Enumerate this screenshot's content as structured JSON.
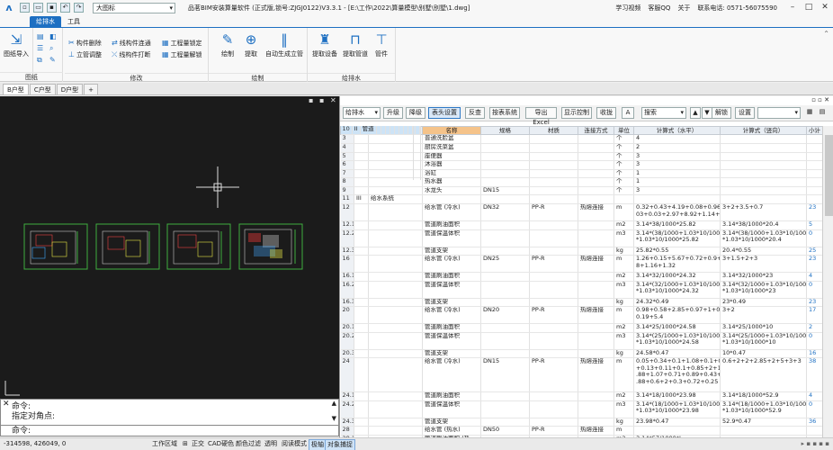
{
  "title_bar": {
    "app_title": "品茗BIM安装算量软件 (正式版,锁号:ZJGJ0122)V3.3.1 - [E:\\工作\\2022\\算量模型\\别墅\\别墅\\1.dwg]",
    "style_select": "大图标",
    "right_links": [
      "学习视频",
      "客服QQ",
      "关于",
      "联系电话: 0571-56075590"
    ]
  },
  "ribbon_tabs": [
    "给排水",
    "工具"
  ],
  "ribbon": {
    "groups": [
      {
        "label": "图纸",
        "buttons": [
          "图纸导入"
        ]
      },
      {
        "label": "修改",
        "buttons": [
          "构件删除",
          "线构件连通",
          "工程量锁定",
          "立管调整",
          "线构件打断",
          "工程量解锁"
        ]
      },
      {
        "label": "绘制",
        "buttons": [
          "绘制",
          "提取",
          "自动生成立管"
        ]
      },
      {
        "label": "给排水",
        "buttons": [
          "提取设备",
          "提取管道",
          "管件"
        ]
      }
    ]
  },
  "doc_tabs": [
    "B户型",
    "C户型",
    "D户型",
    "+"
  ],
  "command": {
    "line1": "命令:",
    "line2": "指定对角点:",
    "prompt": "命令:"
  },
  "status": {
    "coords": "-314598, 426049, 0",
    "items": [
      "工作区域",
      "正交",
      "CAD硬色",
      "颜色过滤",
      "透明",
      "阅读模式",
      "极轴",
      "对象捕捉"
    ]
  },
  "toolbar": {
    "system_select": "给排水",
    "buttons": [
      "升级",
      "降级",
      "表头设置",
      "反查",
      "按表系统",
      "导出Excel",
      "显示控制",
      "收拢",
      "A"
    ],
    "search_placeholder": "搜索",
    "buttons2": [
      "解锁",
      "设置"
    ]
  },
  "table": {
    "headers": [
      "",
      "图标",
      "计算部位",
      "名称",
      "规格",
      "材质",
      "连接方式",
      "单位",
      "计算式（水平）",
      "计算式（竖向）",
      "小计"
    ],
    "rows": [
      {
        "n": "1",
        "icon": "I",
        "part": "水系统",
        "name": "",
        "spec": "",
        "mat": "",
        "conn": "",
        "unit": "",
        "h": "",
        "v": "",
        "sub": "",
        "group": true,
        "sel": true
      },
      {
        "n": "2",
        "icon": "II",
        "part": "卫生器具",
        "name": "",
        "spec": "",
        "mat": "",
        "conn": "",
        "unit": "",
        "h": "",
        "v": "",
        "sub": "",
        "group": true
      },
      {
        "n": "3",
        "icon": "",
        "part": "",
        "name": "普通洗脸盆",
        "spec": "",
        "mat": "",
        "conn": "",
        "unit": "个",
        "h": "4",
        "v": "",
        "sub": ""
      },
      {
        "n": "4",
        "icon": "",
        "part": "",
        "name": "厨房洗菜盆",
        "spec": "",
        "mat": "",
        "conn": "",
        "unit": "个",
        "h": "2",
        "v": "",
        "sub": ""
      },
      {
        "n": "5",
        "icon": "",
        "part": "",
        "name": "座便器",
        "spec": "",
        "mat": "",
        "conn": "",
        "unit": "个",
        "h": "3",
        "v": "",
        "sub": ""
      },
      {
        "n": "6",
        "icon": "",
        "part": "",
        "name": "沐浴器",
        "spec": "",
        "mat": "",
        "conn": "",
        "unit": "个",
        "h": "3",
        "v": "",
        "sub": ""
      },
      {
        "n": "7",
        "icon": "",
        "part": "",
        "name": "浴缸",
        "spec": "",
        "mat": "",
        "conn": "",
        "unit": "个",
        "h": "1",
        "v": "",
        "sub": ""
      },
      {
        "n": "8",
        "icon": "",
        "part": "",
        "name": "热水器",
        "spec": "",
        "mat": "",
        "conn": "",
        "unit": "个",
        "h": "1",
        "v": "",
        "sub": ""
      },
      {
        "n": "9",
        "icon": "",
        "part": "",
        "name": "水龙头",
        "spec": "DN15",
        "mat": "",
        "conn": "",
        "unit": "个",
        "h": "3",
        "v": "",
        "sub": ""
      },
      {
        "n": "10",
        "icon": "II",
        "part": "管道",
        "name": "",
        "spec": "",
        "mat": "",
        "conn": "",
        "unit": "",
        "h": "",
        "v": "",
        "sub": "",
        "group": true
      },
      {
        "n": "11",
        "icon": "III",
        "part": "给水系统",
        "name": "",
        "spec": "",
        "mat": "",
        "conn": "",
        "unit": "",
        "h": "",
        "v": "",
        "sub": ""
      },
      {
        "n": "12",
        "icon": "",
        "part": "",
        "name": "给水管 (冷水)",
        "spec": "DN32",
        "mat": "PP-R",
        "conn": "热熔连接",
        "unit": "m",
        "h": "0.32+0.43+4.19+0.08+0.96+1.",
        "h2": "03+0.03+2.97+8.92+1.14+0.34",
        "v": "3+2+3.5+0.7",
        "sub": "23"
      },
      {
        "n": "12.1",
        "icon": "",
        "part": "",
        "name": "管道刷油面积",
        "spec": "",
        "mat": "",
        "conn": "",
        "unit": "m2",
        "h": "3.14*38/1000*25.82",
        "v": "3.14*38/1000*20.4",
        "sub": "5"
      },
      {
        "n": "12.2",
        "icon": "",
        "part": "",
        "name": "管道保温体积",
        "spec": "",
        "mat": "",
        "conn": "",
        "unit": "m3",
        "h": "3.14*(38/1000+1.03*10/1000)",
        "h2": "*1.03*10/1000*25.82",
        "v": "3.14*(38/1000+1.03*10/1000)",
        "v2": "*1.03*10/1000*20.4",
        "sub": "0"
      },
      {
        "n": "12.3",
        "icon": "",
        "part": "",
        "name": "管道支架",
        "spec": "",
        "mat": "",
        "conn": "",
        "unit": "kg",
        "h": "25.82*0.55",
        "v": "20.4*0.55",
        "sub": "25"
      },
      {
        "n": "16",
        "icon": "",
        "part": "",
        "name": "给水管 (冷水)",
        "spec": "DN25",
        "mat": "PP-R",
        "conn": "热熔连接",
        "unit": "m",
        "h": "1.26+0.15+5.67+0.72+0.9+6.9",
        "h2": "8+1.16+1.32",
        "v": "3+1.5+2+3",
        "sub": "23"
      },
      {
        "n": "16.1",
        "icon": "",
        "part": "",
        "name": "管道刷油面积",
        "spec": "",
        "mat": "",
        "conn": "",
        "unit": "m2",
        "h": "3.14*32/1000*24.32",
        "v": "3.14*32/1000*23",
        "sub": "4"
      },
      {
        "n": "16.2",
        "icon": "",
        "part": "",
        "name": "管道保温体积",
        "spec": "",
        "mat": "",
        "conn": "",
        "unit": "m3",
        "h": "3.14*(32/1000+1.03*10/1000)",
        "h2": "*1.03*10/1000*24.32",
        "v": "3.14*(32/1000+1.03*10/1000)",
        "v2": "*1.03*10/1000*23",
        "sub": "0"
      },
      {
        "n": "16.3",
        "icon": "",
        "part": "",
        "name": "管道支架",
        "spec": "",
        "mat": "",
        "conn": "",
        "unit": "kg",
        "h": "24.32*0.49",
        "v": "23*0.49",
        "sub": "23"
      },
      {
        "n": "20",
        "icon": "",
        "part": "",
        "name": "给水管 (冷水)",
        "spec": "DN20",
        "mat": "PP-R",
        "conn": "热熔连接",
        "unit": "m",
        "h": "0.98+0.58+2.85+0.97+1+0.32+",
        "h2": "0.19+5.4",
        "v": "3+2",
        "sub": "17"
      },
      {
        "n": "20.1",
        "icon": "",
        "part": "",
        "name": "管道刷油面积",
        "spec": "",
        "mat": "",
        "conn": "",
        "unit": "m2",
        "h": "3.14*25/1000*24.58",
        "v": "3.14*25/1000*10",
        "sub": "2"
      },
      {
        "n": "20.2",
        "icon": "",
        "part": "",
        "name": "管道保温体积",
        "spec": "",
        "mat": "",
        "conn": "",
        "unit": "m3",
        "h": "3.14*(25/1000+1.03*10/1000)",
        "h2": "*1.03*10/1000*24.58",
        "v": "3.14*(25/1000+1.03*10/1000)",
        "v2": "*1.03*10/1000*10",
        "sub": "0"
      },
      {
        "n": "20.3",
        "icon": "",
        "part": "",
        "name": "管道支架",
        "spec": "",
        "mat": "",
        "conn": "",
        "unit": "kg",
        "h": "24.58*0.47",
        "v": "10*0.47",
        "sub": "16"
      },
      {
        "n": "24",
        "icon": "",
        "part": "",
        "name": "给水管 (冷水)",
        "spec": "DN15",
        "mat": "PP-R",
        "conn": "热熔连接",
        "unit": "m",
        "h": "0.05+0.34+0.1+1.08+0.1+0.58",
        "h2": "+0.13+0.11+0.1+0.85+2+1.64+0",
        "h3": ".88+1.07+0.71+0.89+0.43+2+0",
        "h4": ".88+0.6+2+0.3+0.72+0.25",
        "v": "0.6+2+2+2.85+2+5+3+3",
        "sub": "38"
      },
      {
        "n": "24.1",
        "icon": "",
        "part": "",
        "name": "管道刷油面积",
        "spec": "",
        "mat": "",
        "conn": "",
        "unit": "m2",
        "h": "3.14*18/1000*23.98",
        "v": "3.14*18/1000*52.9",
        "sub": "4"
      },
      {
        "n": "24.2",
        "icon": "",
        "part": "",
        "name": "管道保温体积",
        "spec": "",
        "mat": "",
        "conn": "",
        "unit": "m3",
        "h": "3.14*(18/1000+1.03*10/1000)",
        "h2": "*1.03*10/1000*23.98",
        "v": "3.14*(18/1000+1.03*10/1000)",
        "v2": "*1.03*10/1000*52.9",
        "sub": "0"
      },
      {
        "n": "24.3",
        "icon": "",
        "part": "",
        "name": "管道支架",
        "spec": "",
        "mat": "",
        "conn": "",
        "unit": "kg",
        "h": "23.98*0.47",
        "v": "52.9*0.47",
        "sub": "36"
      },
      {
        "n": "28",
        "icon": "",
        "part": "",
        "name": "给水管 (热水)",
        "spec": "DN50",
        "mat": "PP-R",
        "conn": "热熔连接",
        "unit": "m",
        "h": "",
        "v": "",
        "sub": ""
      },
      {
        "n": "28.1",
        "icon": "",
        "part": "",
        "name": "管道刷油面积 (热",
        "spec": "",
        "mat": "",
        "conn": "",
        "unit": "m2",
        "h": "3.14*57/1000*L",
        "v": "",
        "sub": ""
      },
      {
        "n": "28.2",
        "icon": "",
        "part": "",
        "name": "",
        "spec": "",
        "mat": "",
        "conn": "",
        "unit": "",
        "h": "3.14*(57/1000+1.03*10/1000)",
        "v": "",
        "sub": ""
      }
    ]
  },
  "colors": {
    "accent": "#1d6fc2",
    "cad_bg": "#1b1b1b",
    "group_row": "#cde3f6",
    "header_sel": "#f5c38a"
  }
}
